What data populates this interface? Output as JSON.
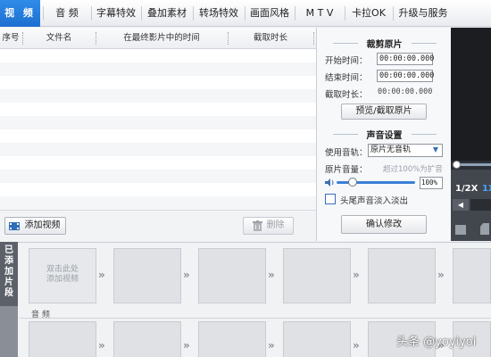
{
  "tabs": [
    {
      "label": "视 频",
      "active": true
    },
    {
      "label": "音 频",
      "active": false
    },
    {
      "label": "字幕特效",
      "active": false
    },
    {
      "label": "叠加素材",
      "active": false
    },
    {
      "label": "转场特效",
      "active": false
    },
    {
      "label": "画面风格",
      "active": false
    },
    {
      "label": "M T V",
      "active": false
    },
    {
      "label": "卡拉OK",
      "active": false
    },
    {
      "label": "升级与服务",
      "active": false
    }
  ],
  "list": {
    "columns": [
      "序号",
      "文件名",
      "在最终影片中的时间",
      "截取时长"
    ],
    "add_button": "添加视频",
    "delete_button": "删除"
  },
  "panel": {
    "crop_title": "裁剪原片",
    "start_label": "开始时间：",
    "start_value": "00:00:00.000",
    "end_label": "结束时间：",
    "end_value": "00:00:00.000",
    "duration_label": "截取时长：",
    "duration_value": "00:00:00.000",
    "preview_button": "预览/截取原片",
    "sound_title": "声音设置",
    "track_label": "使用音轨：",
    "track_value": "原片无音轨",
    "volume_label": "原片音量：",
    "volume_hint": "超过100%为扩音",
    "volume_value": "100%",
    "fade_label": "头尾声音淡入淡出",
    "confirm_button": "确认修改"
  },
  "preview": {
    "speed_label": "1/2X",
    "speed_label2": "1X"
  },
  "timeline": {
    "side_label": [
      "已",
      "添",
      "加",
      "片",
      "段"
    ],
    "first_slot_text": "双击此处\n添加视频",
    "audio_label": "音 频"
  },
  "watermark": "头条 @yoyiyoi"
}
